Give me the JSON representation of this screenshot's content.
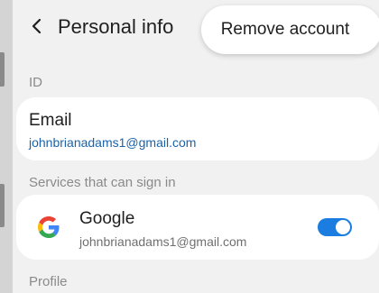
{
  "header": {
    "title": "Personal info",
    "back_icon": "chevron-left-icon"
  },
  "popup_menu": {
    "items": [
      {
        "label": "Remove account"
      }
    ]
  },
  "sections": {
    "id": {
      "label": "ID",
      "email": {
        "title": "Email",
        "value": "johnbrianadams1@gmail.com"
      }
    },
    "services": {
      "label": "Services that can sign in",
      "google": {
        "icon": "google-logo-icon",
        "name": "Google",
        "account": "johnbrianadams1@gmail.com",
        "enabled": true
      }
    },
    "profile": {
      "label": "Profile"
    }
  },
  "colors": {
    "accent": "#1b7de0",
    "link": "#1a63a8",
    "background": "#f1f1f1",
    "card": "#ffffff"
  }
}
